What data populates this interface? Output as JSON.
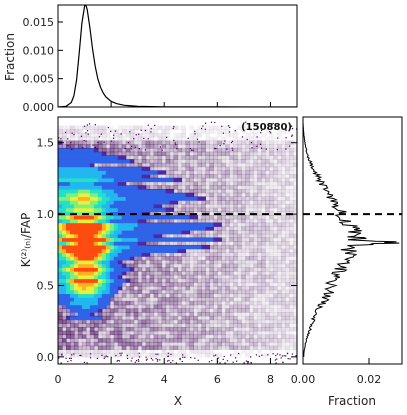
{
  "chart_data": [
    {
      "type": "line",
      "panel": "top-histogram",
      "xlabel": "",
      "ylabel": "Fraction",
      "xlim": [
        0,
        9
      ],
      "ylim": [
        0,
        0.018
      ],
      "x_ticks": [
        0,
        2,
        4,
        6,
        8
      ],
      "y_ticks": [
        0.0,
        0.005,
        0.01,
        0.015
      ],
      "y_tick_labels": [
        "0.000",
        "0.005",
        "0.010",
        "0.015"
      ],
      "x": [
        0.0,
        0.3,
        0.5,
        0.6,
        0.7,
        0.8,
        0.9,
        1.0,
        1.05,
        1.1,
        1.2,
        1.3,
        1.4,
        1.5,
        1.6,
        1.7,
        1.8,
        2.0,
        2.2,
        2.5,
        3.0,
        4.0,
        5.0,
        6.0,
        7.0,
        8.0,
        9.0
      ],
      "y": [
        0.0,
        0.0001,
        0.0008,
        0.002,
        0.0048,
        0.0095,
        0.0148,
        0.0178,
        0.018,
        0.0172,
        0.014,
        0.0103,
        0.0072,
        0.005,
        0.0035,
        0.0025,
        0.0018,
        0.001,
        0.0006,
        0.0003,
        0.00012,
        4e-05,
        2e-05,
        1e-05,
        0.0,
        0.0,
        0.0
      ]
    },
    {
      "type": "heatmap",
      "panel": "main-density",
      "xlabel": "X",
      "ylabel": "K⁽²⁾₍ₙ₎/FAP",
      "xlim": [
        0,
        9
      ],
      "ylim": [
        -0.05,
        1.68
      ],
      "x_ticks": [
        0,
        2,
        4,
        6,
        8
      ],
      "x_tick_labels": [
        "0",
        "2",
        "4",
        "6",
        "8"
      ],
      "y_ticks": [
        0.0,
        0.5,
        1.0,
        1.5
      ],
      "y_tick_labels": [
        "0.0",
        "0.5",
        "1.0",
        "1.5"
      ],
      "annotation": "(150880)",
      "reference_line": {
        "y": 1.0,
        "style": "dashed"
      },
      "density_peak": {
        "x": 1.05,
        "y": 0.75
      },
      "colormap": [
        "#3a0050",
        "#4b2aa8",
        "#2f63e8",
        "#23b7f0",
        "#25e0c8",
        "#7ff07a",
        "#e8f03a",
        "#ffb020",
        "#ff4a10",
        "#d80000"
      ]
    },
    {
      "type": "line",
      "panel": "right-histogram",
      "xlabel": "Fraction",
      "ylabel": "",
      "xlim": [
        0,
        0.03
      ],
      "ylim": [
        -0.05,
        1.68
      ],
      "x_ticks": [
        0.0,
        0.02
      ],
      "x_tick_labels": [
        "0.00",
        "0.02"
      ],
      "reference_line": {
        "y": 1.0,
        "style": "dashed"
      },
      "y": [
        0.0,
        0.05,
        0.1,
        0.15,
        0.2,
        0.25,
        0.3,
        0.35,
        0.4,
        0.45,
        0.5,
        0.55,
        0.6,
        0.65,
        0.7,
        0.75,
        0.78,
        0.8,
        0.82,
        0.85,
        0.9,
        0.95,
        1.0,
        1.05,
        1.1,
        1.15,
        1.2,
        1.25,
        1.3,
        1.35,
        1.4,
        1.45,
        1.5,
        1.55,
        1.6,
        1.65
      ],
      "x": [
        0.0002,
        0.0004,
        0.0008,
        0.0014,
        0.0022,
        0.003,
        0.004,
        0.0052,
        0.0065,
        0.0078,
        0.0085,
        0.0092,
        0.011,
        0.0128,
        0.0135,
        0.014,
        0.015,
        0.0285,
        0.016,
        0.0165,
        0.015,
        0.013,
        0.0118,
        0.01,
        0.0085,
        0.0072,
        0.006,
        0.0048,
        0.0036,
        0.0025,
        0.0016,
        0.001,
        0.0006,
        0.0003,
        0.0001,
        0.0
      ]
    }
  ]
}
